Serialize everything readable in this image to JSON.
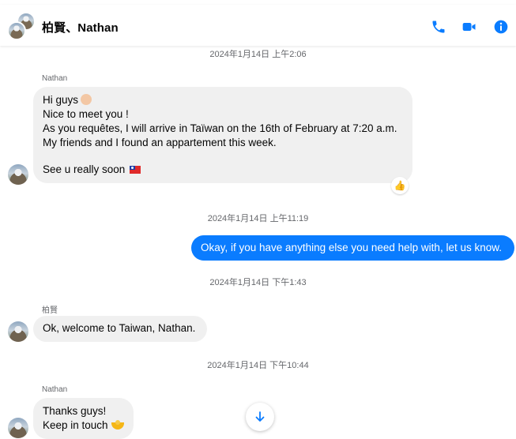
{
  "header": {
    "title": "柏賢、Nathan",
    "icons": [
      "phone-icon",
      "video-icon",
      "info-icon"
    ]
  },
  "colors": {
    "accent": "#0a7cff",
    "incoming_bubble": "#f0f0f0",
    "timestamp_text": "#65676b"
  },
  "messages": {
    "ts1": "2024年1月14日 上午2:06",
    "m1": {
      "sender": "Nathan",
      "lines": [
        "Hi guys",
        "Nice to meet you !",
        "As you requêtes, I will arrive in Taïwan on the 16th of February at 7:20 a.m.",
        "My friends and I found an appartement this week.",
        "See u really soon"
      ],
      "reaction": "👍"
    },
    "ts2": "2024年1月14日 上午11:19",
    "m2": {
      "text": "Okay, if you have anything else you need help with, let us know."
    },
    "ts3": "2024年1月14日 下午1:43",
    "m3": {
      "sender": "柏賢",
      "text": "Ok, welcome to Taiwan, Nathan."
    },
    "ts4": "2024年1月14日 下午10:44",
    "m4": {
      "sender": "Nathan",
      "lines": [
        "Thanks guys!",
        "Keep in touch"
      ]
    }
  }
}
